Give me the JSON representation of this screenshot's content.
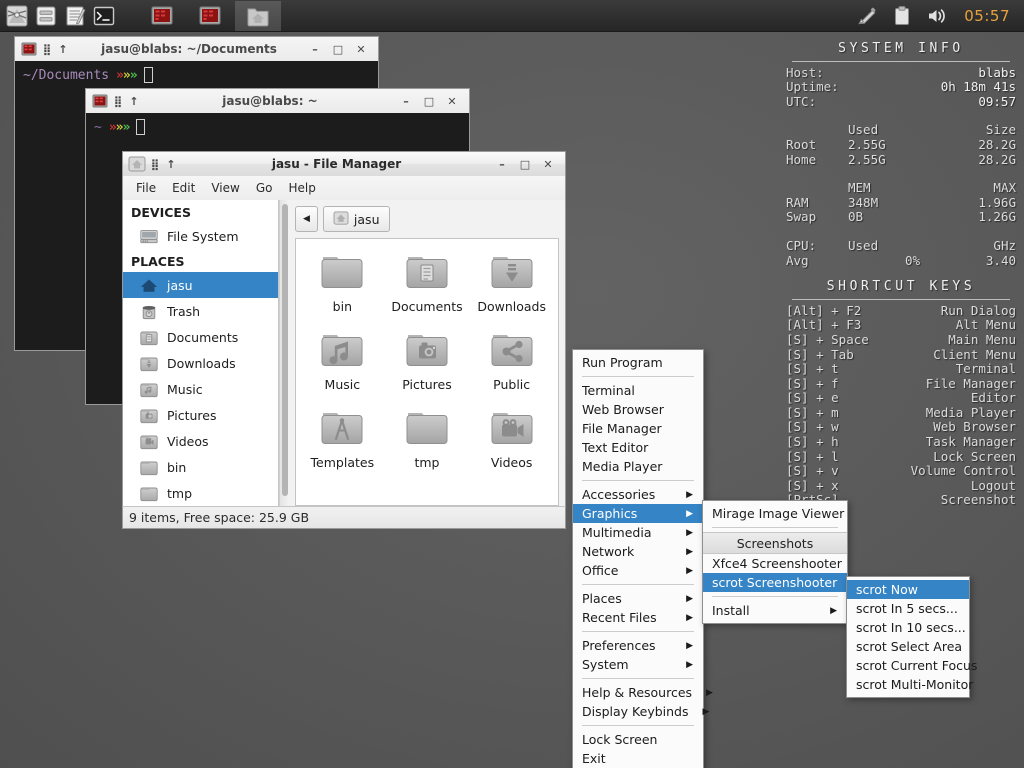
{
  "panel": {
    "launchers": [
      {
        "name": "app-finder-launcher",
        "label": "Application Finder"
      },
      {
        "name": "file-manager-launcher",
        "label": "File Manager"
      },
      {
        "name": "text-editor-launcher",
        "label": "Text Editor"
      },
      {
        "name": "terminal-launcher",
        "label": "Terminal"
      }
    ],
    "tasks": [
      {
        "name": "task-terminal-documents",
        "label": "jasu@blabs: ~/Documents",
        "active": false
      },
      {
        "name": "task-terminal-home",
        "label": "jasu@blabs: ~",
        "active": false
      },
      {
        "name": "task-file-manager",
        "label": "jasu - File Manager",
        "active": true
      }
    ],
    "tray": [
      {
        "name": "screenshot-tray-icon",
        "label": "Screenshot"
      },
      {
        "name": "clipboard-tray-icon",
        "label": "Clipboard Manager"
      },
      {
        "name": "volume-tray-icon",
        "label": "Volume"
      }
    ],
    "clock": "05:57",
    "clock_color": "#e8a33d"
  },
  "sysinfo": {
    "title": "SYSTEM   INFO",
    "host_key": "Host:",
    "host_value": "blabs",
    "uptime_key": "Uptime:",
    "uptime_value": "0h 18m 41s",
    "utc_key": "UTC:",
    "utc_value": "09:57",
    "disk_header": {
      "used": "Used",
      "size": "Size"
    },
    "disk_rows": [
      {
        "label": "Root",
        "used": "2.55G",
        "size": "28.2G"
      },
      {
        "label": "Home",
        "used": "2.55G",
        "size": "28.2G"
      }
    ],
    "mem_header": {
      "mem": "MEM",
      "max": "MAX"
    },
    "mem_rows": [
      {
        "label": "RAM",
        "used": "348M",
        "max": "1.96G"
      },
      {
        "label": "Swap",
        "used": "0B",
        "max": "1.26G"
      }
    ],
    "cpu_header": {
      "cpu": "CPU:",
      "used": "Used",
      "ghz": "GHz"
    },
    "cpu_row": {
      "label": "Avg",
      "used": "0%",
      "ghz": "3.40"
    },
    "shortcut_title": "SHORTCUT   KEYS",
    "shortcuts": [
      {
        "keys": "[Alt] + F2",
        "action": "Run Dialog"
      },
      {
        "keys": "[Alt] + F3",
        "action": "Alt Menu"
      },
      {
        "keys": "[S] + Space",
        "action": "Main Menu"
      },
      {
        "keys": "[S] + Tab",
        "action": "Client Menu"
      },
      {
        "keys": "[S] + t",
        "action": "Terminal"
      },
      {
        "keys": "[S] + f",
        "action": "File Manager"
      },
      {
        "keys": "[S] + e",
        "action": "Editor"
      },
      {
        "keys": "[S] + m",
        "action": "Media Player"
      },
      {
        "keys": "[S] + w",
        "action": "Web Browser"
      },
      {
        "keys": "[S] + h",
        "action": "Task Manager"
      },
      {
        "keys": "[S] + l",
        "action": "Lock Screen"
      },
      {
        "keys": "[S] + v",
        "action": "Volume Control"
      },
      {
        "keys": "[S] + x",
        "action": "Logout"
      },
      {
        "keys": "[PrtSc]",
        "action": "Screenshot"
      }
    ]
  },
  "term1": {
    "title": "jasu@blabs: ~/Documents",
    "prompt_path": "~/Documents",
    "chevrons": "»»»",
    "min": "–",
    "max": "□",
    "close": "✕"
  },
  "term2": {
    "title": "jasu@blabs: ~",
    "prompt_path": "~",
    "chevrons": "»»»",
    "min": "–",
    "max": "□",
    "close": "✕"
  },
  "filemanager": {
    "title": "jasu - File Manager",
    "min": "–",
    "max": "□",
    "close": "✕",
    "menubar": [
      "File",
      "Edit",
      "View",
      "Go",
      "Help"
    ],
    "sidebar": {
      "devices_header": "DEVICES",
      "devices": [
        {
          "label": "File System",
          "icon": "drive-icon"
        }
      ],
      "places_header": "PLACES",
      "places": [
        {
          "label": "jasu",
          "icon": "home-icon",
          "selected": true
        },
        {
          "label": "Trash",
          "icon": "trash-icon",
          "selected": false
        },
        {
          "label": "Documents",
          "icon": "documents-folder-icon",
          "selected": false
        },
        {
          "label": "Downloads",
          "icon": "downloads-folder-icon",
          "selected": false
        },
        {
          "label": "Music",
          "icon": "music-folder-icon",
          "selected": false
        },
        {
          "label": "Pictures",
          "icon": "pictures-folder-icon",
          "selected": false
        },
        {
          "label": "Videos",
          "icon": "videos-folder-icon",
          "selected": false
        },
        {
          "label": "bin",
          "icon": "folder-icon",
          "selected": false
        },
        {
          "label": "tmp",
          "icon": "folder-icon",
          "selected": false
        }
      ]
    },
    "pathbar": {
      "back_glyph": "◀",
      "crumb": "jasu"
    },
    "files": [
      {
        "label": "bin",
        "icon": "folder-icon"
      },
      {
        "label": "Documents",
        "icon": "documents-folder-icon"
      },
      {
        "label": "Downloads",
        "icon": "downloads-folder-icon"
      },
      {
        "label": "Music",
        "icon": "music-folder-icon"
      },
      {
        "label": "Pictures",
        "icon": "pictures-folder-icon"
      },
      {
        "label": "Public",
        "icon": "public-folder-icon"
      },
      {
        "label": "Templates",
        "icon": "templates-folder-icon"
      },
      {
        "label": "tmp",
        "icon": "folder-icon"
      },
      {
        "label": "Videos",
        "icon": "videos-folder-icon"
      }
    ],
    "status": "9 items, Free space: 25.9 GB"
  },
  "menu_main": {
    "items": [
      {
        "label": "Run Program",
        "submenu": false,
        "selected": false
      },
      {
        "sep": true
      },
      {
        "label": "Terminal",
        "submenu": false,
        "selected": false
      },
      {
        "label": "Web Browser",
        "submenu": false,
        "selected": false
      },
      {
        "label": "File Manager",
        "submenu": false,
        "selected": false
      },
      {
        "label": "Text Editor",
        "submenu": false,
        "selected": false
      },
      {
        "label": "Media Player",
        "submenu": false,
        "selected": false
      },
      {
        "sep": true
      },
      {
        "label": "Accessories",
        "submenu": true,
        "selected": false
      },
      {
        "label": "Graphics",
        "submenu": true,
        "selected": true
      },
      {
        "label": "Multimedia",
        "submenu": true,
        "selected": false
      },
      {
        "label": "Network",
        "submenu": true,
        "selected": false
      },
      {
        "label": "Office",
        "submenu": true,
        "selected": false
      },
      {
        "sep": true
      },
      {
        "label": "Places",
        "submenu": true,
        "selected": false
      },
      {
        "label": "Recent Files",
        "submenu": true,
        "selected": false
      },
      {
        "sep": true
      },
      {
        "label": "Preferences",
        "submenu": true,
        "selected": false
      },
      {
        "label": "System",
        "submenu": true,
        "selected": false
      },
      {
        "sep": true
      },
      {
        "label": "Help & Resources",
        "submenu": true,
        "selected": false
      },
      {
        "label": "Display Keybinds",
        "submenu": true,
        "selected": false
      },
      {
        "sep": true
      },
      {
        "label": "Lock Screen",
        "submenu": false,
        "selected": false
      },
      {
        "label": "Exit",
        "submenu": false,
        "selected": false
      }
    ]
  },
  "menu_graphics": {
    "items": [
      {
        "label": "Mirage Image Viewer",
        "submenu": false,
        "selected": false
      },
      {
        "sep": true
      },
      {
        "label": "Screenshots",
        "header": true
      },
      {
        "label": "Xfce4 Screenshooter",
        "submenu": false,
        "selected": false
      },
      {
        "label": "scrot Screenshooter",
        "submenu": true,
        "selected": true
      },
      {
        "sep": true
      },
      {
        "label": "Install",
        "submenu": true,
        "selected": false
      }
    ]
  },
  "menu_scrot": {
    "items": [
      {
        "label": "scrot Now",
        "selected": true
      },
      {
        "label": "scrot In 5 secs...",
        "selected": false
      },
      {
        "label": "scrot In 10 secs...",
        "selected": false
      },
      {
        "label": "scrot Select Area",
        "selected": false
      },
      {
        "label": "scrot Current Focus",
        "selected": false
      },
      {
        "label": "scrot Multi-Monitor",
        "selected": false
      }
    ]
  },
  "colors": {
    "selection_blue": "#3584c6",
    "desktop_gray": "#5a5a5a",
    "panel_dark": "#303030",
    "terminal_bg": "#1c1c1c",
    "clock_orange": "#e8a33d",
    "chevron_red": "#cc3333",
    "chevron_yellow": "#cfcf3a",
    "chevron_green": "#4fbf4f"
  }
}
